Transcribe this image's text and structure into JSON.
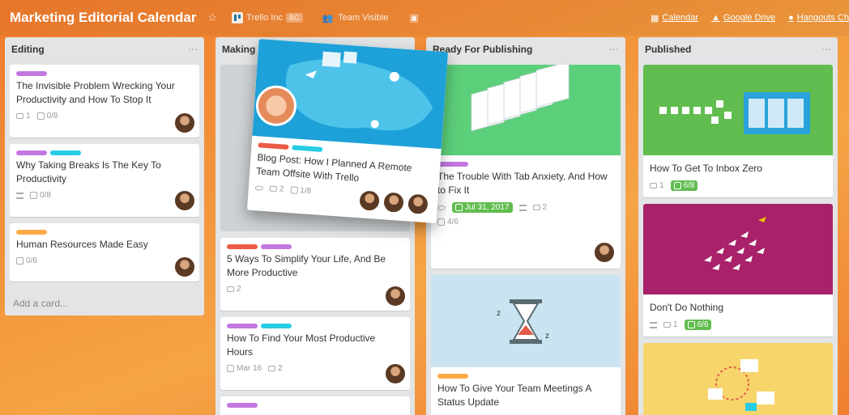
{
  "header": {
    "board_title": "Marketing Editorial Calendar",
    "team_name": "Trello Inc",
    "team_badge": "BC",
    "visibility": "Team Visible",
    "power_ups": {
      "calendar": "Calendar",
      "drive": "Google Drive",
      "hangouts": "Hangouts Ch"
    }
  },
  "lists": [
    {
      "title": "Editing",
      "cards": [
        {
          "title": "The Invisible Problem Wrecking Your Productivity and How To Stop It",
          "comments": "1",
          "checklist": "0/8"
        },
        {
          "title": "Why Taking Breaks Is The Key To Productivity",
          "checklist": "0/8"
        },
        {
          "title": "Human Resources Made Easy",
          "checklist": "0/6"
        }
      ],
      "add_card": "Add a card..."
    },
    {
      "title": "Making",
      "cards": [
        {
          "title": "5 Ways To Simplify Your Life, And Be More Productive",
          "comments": "2"
        },
        {
          "title": "How To Find Your Most Productive Hours",
          "due": "Mar 16",
          "comments": "2"
        }
      ]
    },
    {
      "title": "Ready For Publishing",
      "cards": [
        {
          "title": "The Trouble With Tab Anxiety, And How to Fix It",
          "due": "Jul 31, 2017",
          "comments": "2",
          "checklist": "4/6"
        },
        {
          "title": "How To Give Your Team Meetings A Status Update"
        }
      ]
    },
    {
      "title": "Published",
      "cards": [
        {
          "title": "How To Get To Inbox Zero",
          "comments": "1",
          "checklist": "6/8"
        },
        {
          "title": "Don't Do Nothing",
          "comments": "1",
          "checklist": "6/6"
        }
      ]
    }
  ],
  "dragged_card": {
    "title": "Blog Post: How I Planned A Remote Team Offsite With Trello",
    "comments": "2",
    "checklist": "1/8"
  },
  "colors": {
    "purple": "#c377e0",
    "blue": "#29cce5",
    "orange": "#ffab4a",
    "red": "#eb5a46",
    "green": "#61bd4f"
  }
}
